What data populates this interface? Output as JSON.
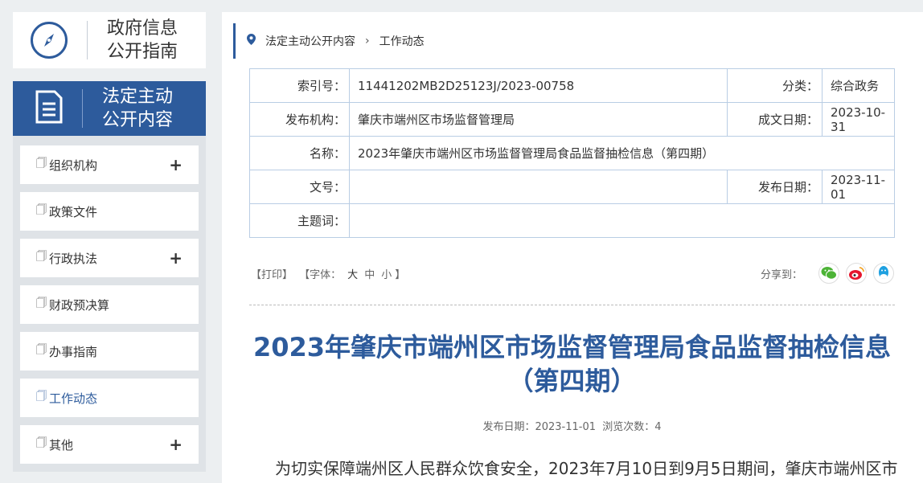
{
  "sidebar": {
    "guide": {
      "line1": "政府信息",
      "line2": "公开指南",
      "icon": "compass-icon"
    },
    "active": {
      "line1": "法定主动",
      "line2": "公开内容",
      "icon": "document-icon"
    },
    "items": [
      {
        "label": "组织机构",
        "expandable": "+"
      },
      {
        "label": "政策文件",
        "expandable": ""
      },
      {
        "label": "行政执法",
        "expandable": "+"
      },
      {
        "label": "财政预决算",
        "expandable": ""
      },
      {
        "label": "办事指南",
        "expandable": ""
      },
      {
        "label": "工作动态",
        "expandable": ""
      },
      {
        "label": "其他",
        "expandable": "+"
      }
    ]
  },
  "breadcrumb": {
    "level1": "法定主动公开内容",
    "separator": "›",
    "level2": "工作动态"
  },
  "meta": {
    "index_label": "索引号：",
    "index_value": "11441202MB2D25123J/2023-00758",
    "category_label": "分类：",
    "category_value": "综合政务",
    "publisher_label": "发布机构：",
    "publisher_value": "肇庆市端州区市场监督管理局",
    "created_label": "成文日期：",
    "created_value": "2023-10-31",
    "name_label": "名称：",
    "name_value": "2023年肇庆市端州区市场监督管理局食品监督抽检信息（第四期）",
    "docno_label": "文号：",
    "docno_value": "",
    "pubdate_label": "发布日期：",
    "pubdate_value": "2023-11-01",
    "keywords_label": "主题词：",
    "keywords_value": ""
  },
  "toolbar": {
    "print": "【打印】",
    "font_prefix": "【字体：",
    "font_large": "大",
    "font_medium": "中",
    "font_small": "小",
    "font_suffix": "】",
    "share_label": "分享到：",
    "share_icons": [
      "wechat-icon",
      "weibo-icon",
      "qq-icon"
    ]
  },
  "article": {
    "title_line1": "2023年肇庆市端州区市场监督管理局食品监督抽检信息",
    "title_line2": "（第四期）",
    "pubinfo": "发布日期：2023-11-01  浏览次数：4",
    "paragraph": "为切实保障端州区人民群众饮食安全，2023年7月10日到9月5日期间，肇庆市端州区市"
  },
  "colors": {
    "accent": "#2d5b9c",
    "border": "#b9cde4",
    "background": "#eceff1"
  }
}
